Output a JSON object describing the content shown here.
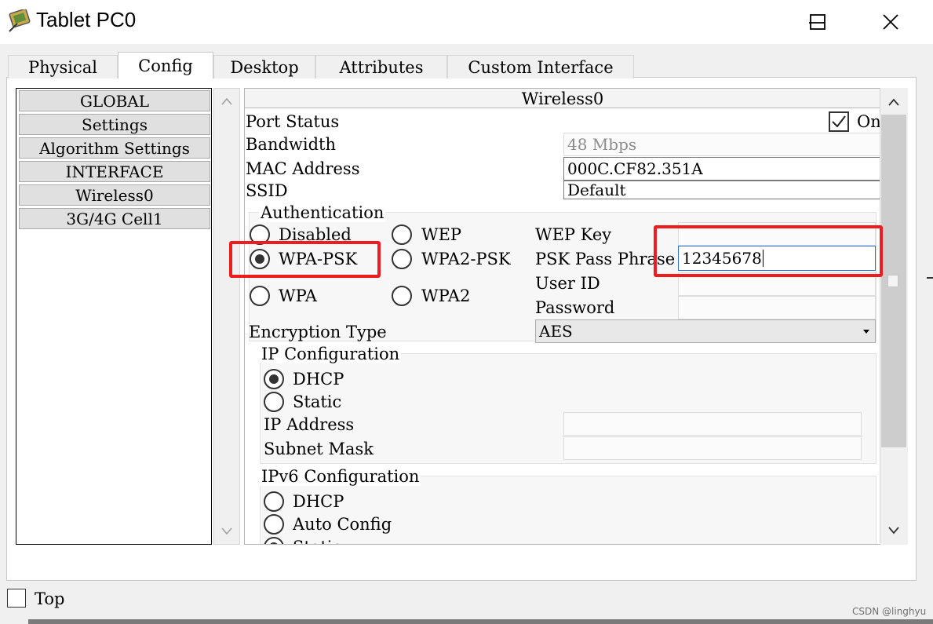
{
  "window": {
    "title": "Tablet PC0"
  },
  "tabs": [
    {
      "label": "Physical"
    },
    {
      "label": "Config"
    },
    {
      "label": "Desktop"
    },
    {
      "label": "Attributes"
    },
    {
      "label": "Custom Interface"
    }
  ],
  "left_list": {
    "items": [
      {
        "label": "GLOBAL"
      },
      {
        "label": "Settings"
      },
      {
        "label": "Algorithm Settings"
      },
      {
        "label": "INTERFACE"
      },
      {
        "label": "Wireless0"
      },
      {
        "label": "3G/4G Cell1"
      }
    ]
  },
  "panel": {
    "header": "Wireless0",
    "port_status_label": "Port Status",
    "on_label": "On",
    "port_on": true,
    "bandwidth_label": "Bandwidth",
    "bandwidth_value": "48 Mbps",
    "mac_label": "MAC Address",
    "mac_value": "000C.CF82.351A",
    "ssid_label": "SSID",
    "ssid_value": "Default",
    "authentication": {
      "title": "Authentication",
      "disabled": "Disabled",
      "wep": "WEP",
      "wpa_psk": "WPA-PSK",
      "wpa2_psk": "WPA2-PSK",
      "wpa": "WPA",
      "wpa2": "WPA2",
      "selected": "WPA-PSK",
      "wep_key_label": "WEP Key",
      "psk_label": "PSK Pass Phrase",
      "psk_value": "12345678",
      "user_id_label": "User ID",
      "password_label": "Password"
    },
    "encryption_label": "Encryption Type",
    "encryption_value": "AES",
    "ip_config": {
      "title": "IP Configuration",
      "dhcp": "DHCP",
      "static": "Static",
      "selected": "DHCP",
      "ip_label": "IP Address",
      "subnet_label": "Subnet Mask"
    },
    "ipv6_config": {
      "title": "IPv6 Configuration",
      "dhcp": "DHCP",
      "auto": "Auto Config",
      "static": "Static"
    }
  },
  "footer": {
    "top_label": "Top"
  },
  "watermark": "CSDN @linghyu",
  "colors": {
    "highlight": "#ee1c1c",
    "focus_border": "#2a6fd6"
  }
}
